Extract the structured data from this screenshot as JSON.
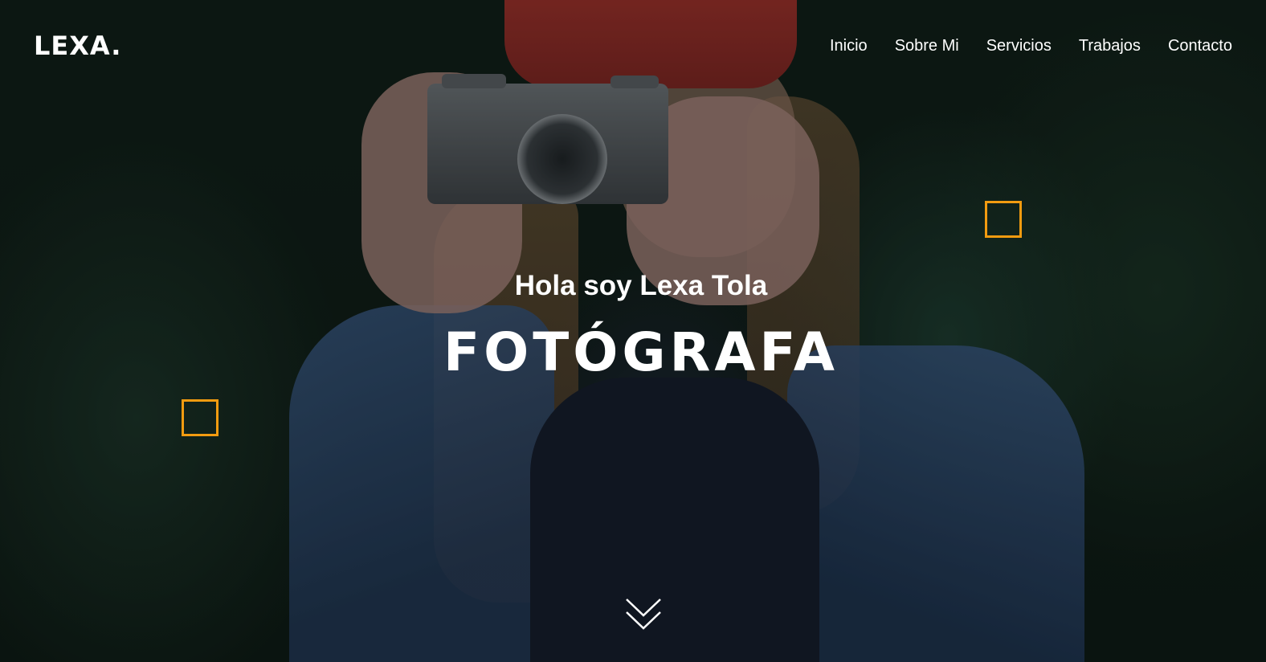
{
  "header": {
    "logo": "LEXA.",
    "nav": [
      {
        "label": "Inicio"
      },
      {
        "label": "Sobre Mi"
      },
      {
        "label": "Servicios"
      },
      {
        "label": "Trabajos"
      },
      {
        "label": "Contacto"
      }
    ]
  },
  "hero": {
    "greeting": "Hola soy Lexa Tola",
    "title": "FOTÓGRAFA",
    "background_image": "woman-with-camera-in-forest-photo",
    "scroll_icon": "double-chevron-down-icon"
  },
  "colors": {
    "accent": "#f29b10",
    "text": "#ffffff"
  }
}
